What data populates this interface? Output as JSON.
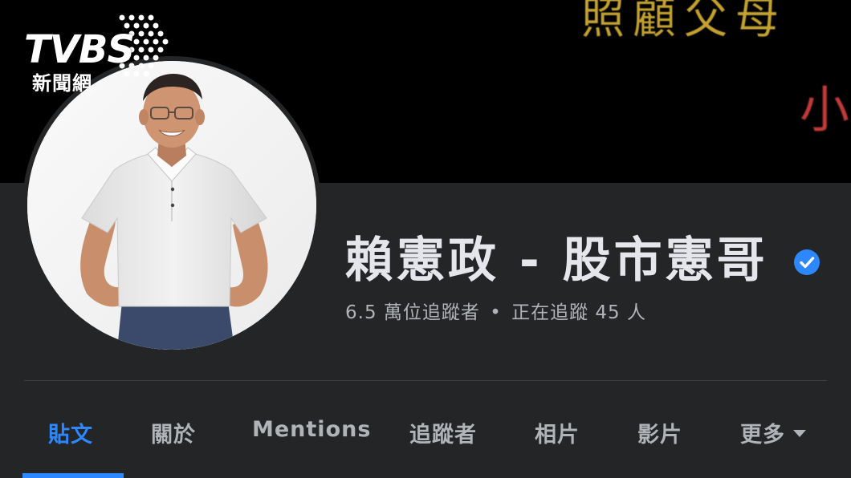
{
  "brand": {
    "logo_main": "TVBS",
    "logo_sub": "新聞網"
  },
  "cover": {
    "text_yellow": "照顧父母",
    "text_red": "小"
  },
  "profile": {
    "name": "賴憲政 - 股市憲哥",
    "verified": true,
    "followers_count": "6.5 萬位追蹤者",
    "separator": "•",
    "following_count": "正在追蹤 45 人"
  },
  "tabs": [
    {
      "label": "貼文",
      "active": true
    },
    {
      "label": "關於",
      "active": false
    },
    {
      "label": "Mentions",
      "active": false
    },
    {
      "label": "追蹤者",
      "active": false
    },
    {
      "label": "相片",
      "active": false
    },
    {
      "label": "影片",
      "active": false
    },
    {
      "label": "更多",
      "active": false
    }
  ],
  "colors": {
    "background": "#242526",
    "accent": "#2d88ff",
    "text_primary": "#e4e6eb",
    "text_secondary": "#b0b3b8",
    "cover": "#000000"
  },
  "icons": {
    "verified": "verified-badge-icon",
    "more": "chevron-down-icon"
  }
}
